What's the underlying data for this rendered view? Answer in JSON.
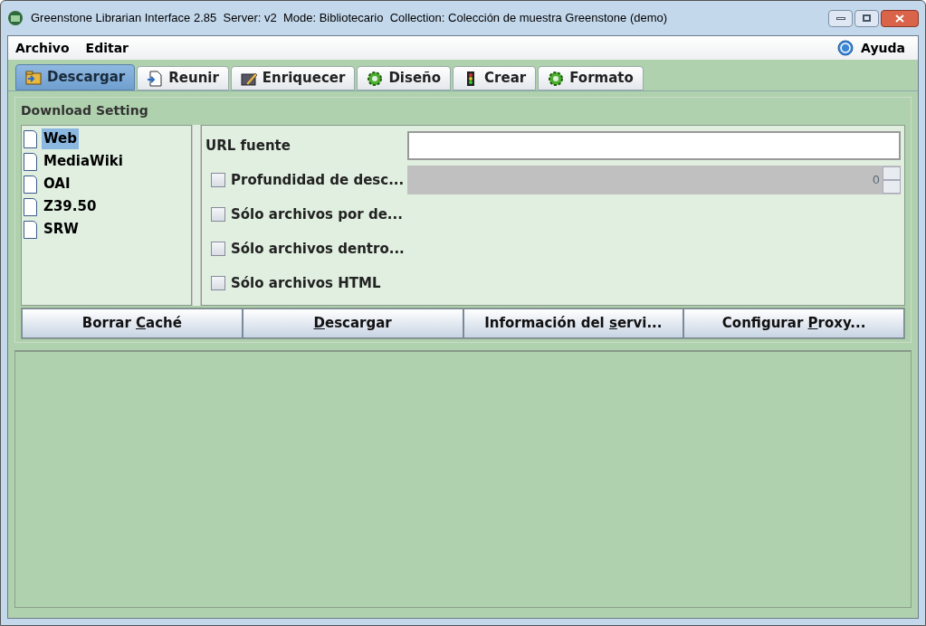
{
  "window": {
    "title": "Greenstone Librarian Interface 2.85  Server: v2  Mode: Bibliotecario  Collection: Colección de muestra Greenstone (demo)"
  },
  "menu": [
    "Archivo",
    "Editar"
  ],
  "help": "Ayuda",
  "tabs": [
    {
      "label": "Descargar",
      "kind": "folder",
      "selected": true
    },
    {
      "label": "Reunir",
      "kind": "doc",
      "selected": false
    },
    {
      "label": "Enriquecer",
      "kind": "pencil",
      "selected": false
    },
    {
      "label": "Diseño",
      "kind": "gear",
      "selected": false
    },
    {
      "label": "Crear",
      "kind": "light",
      "selected": false
    },
    {
      "label": "Formato",
      "kind": "gear",
      "selected": false
    }
  ],
  "panel": {
    "title": "Download Setting",
    "sources": [
      {
        "label": "Web",
        "selected": true
      },
      {
        "label": "MediaWiki",
        "selected": false
      },
      {
        "label": "OAI",
        "selected": false
      },
      {
        "label": "Z39.50",
        "selected": false
      },
      {
        "label": "SRW",
        "selected": false
      }
    ],
    "fields": [
      {
        "kind": "text",
        "label": "URL fuente"
      },
      {
        "kind": "spinner",
        "label": "Profundidad de desc...",
        "checked": false,
        "value": "0"
      },
      {
        "kind": "check",
        "label": "Sólo archivos por de...",
        "checked": false
      },
      {
        "kind": "check",
        "label": "Sólo archivos dentro...",
        "checked": false
      },
      {
        "kind": "check",
        "label": "Sólo archivos HTML",
        "checked": false
      }
    ],
    "buttons": [
      {
        "before": "Borrar ",
        "key": "C",
        "after": "aché"
      },
      {
        "key": "D",
        "after": "escargar"
      },
      {
        "before": "Información del ",
        "key": "s",
        "after": "ervi..."
      },
      {
        "before": "Configurar ",
        "key": "P",
        "after": "roxy..."
      }
    ]
  }
}
